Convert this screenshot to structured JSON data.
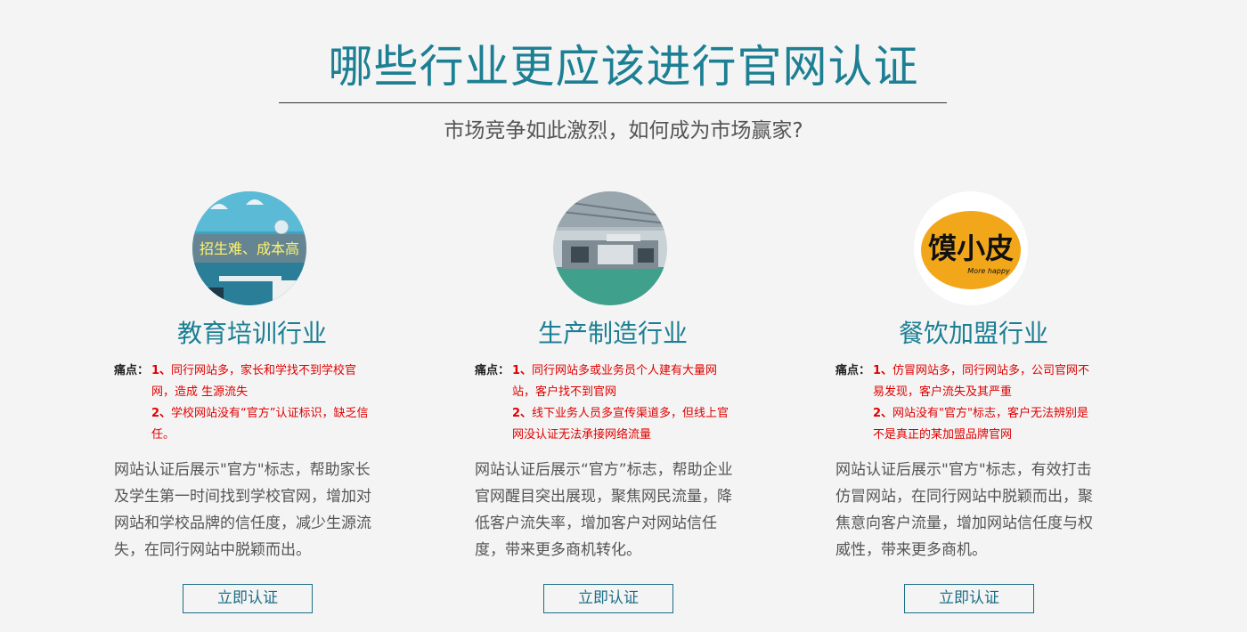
{
  "page": {
    "title": "哪些行业更应该进行官网认证",
    "subtitle": "市场竞争如此激烈，如何成为市场赢家?"
  },
  "cards": [
    {
      "title": "教育培训行业",
      "image_text": "招生难、成本高",
      "pain_label": "痛点：",
      "pains": [
        {
          "num": "1、",
          "text": "同行网站多，家长和学找不到学校官网，造成 生源流失"
        },
        {
          "num": "2、",
          "text": "学校网站没有“官方”认证标识，缺乏信任。"
        }
      ],
      "description": "网站认证后展示\"官方\"标志，帮助家长及学生第一时间找到学校官网，增加对网站和学校品牌的信任度，减少生源流失，在同行网站中脱颖而出。",
      "button": "立即认证"
    },
    {
      "title": "生产制造行业",
      "pain_label": "痛点：",
      "pains": [
        {
          "num": "1、",
          "text": "同行网站多或业务员个人建有大量网站，客户找不到官网"
        },
        {
          "num": "2、",
          "text": "线下业务人员多宣传渠道多，但线上官网没认证无法承接网络流量"
        }
      ],
      "description": "网站认证后展示“官方”标志，帮助企业官网醒目突出展现，聚焦网民流量，降低客户流失率，增加客户对网站信任度，带来更多商机转化。",
      "button": "立即认证"
    },
    {
      "title": "餐饮加盟行业",
      "logo_text": "馍小皮",
      "logo_sub": "More happy",
      "pain_label": "痛点：",
      "pains": [
        {
          "num": "1、",
          "text": "仿冒网站多，同行网站多，公司官网不易发现，客户流失及其严重"
        },
        {
          "num": "2、",
          "text": "网站没有\"官方\"标志，客户无法辨别是不是真正的某加盟品牌官网"
        }
      ],
      "description": "网站认证后展示\"官方\"标志，有效打击仿冒网站，在同行网站中脱颖而出，聚焦意向客户流量，增加网站信任度与权威性，带来更多商机。",
      "button": "立即认证"
    }
  ]
}
